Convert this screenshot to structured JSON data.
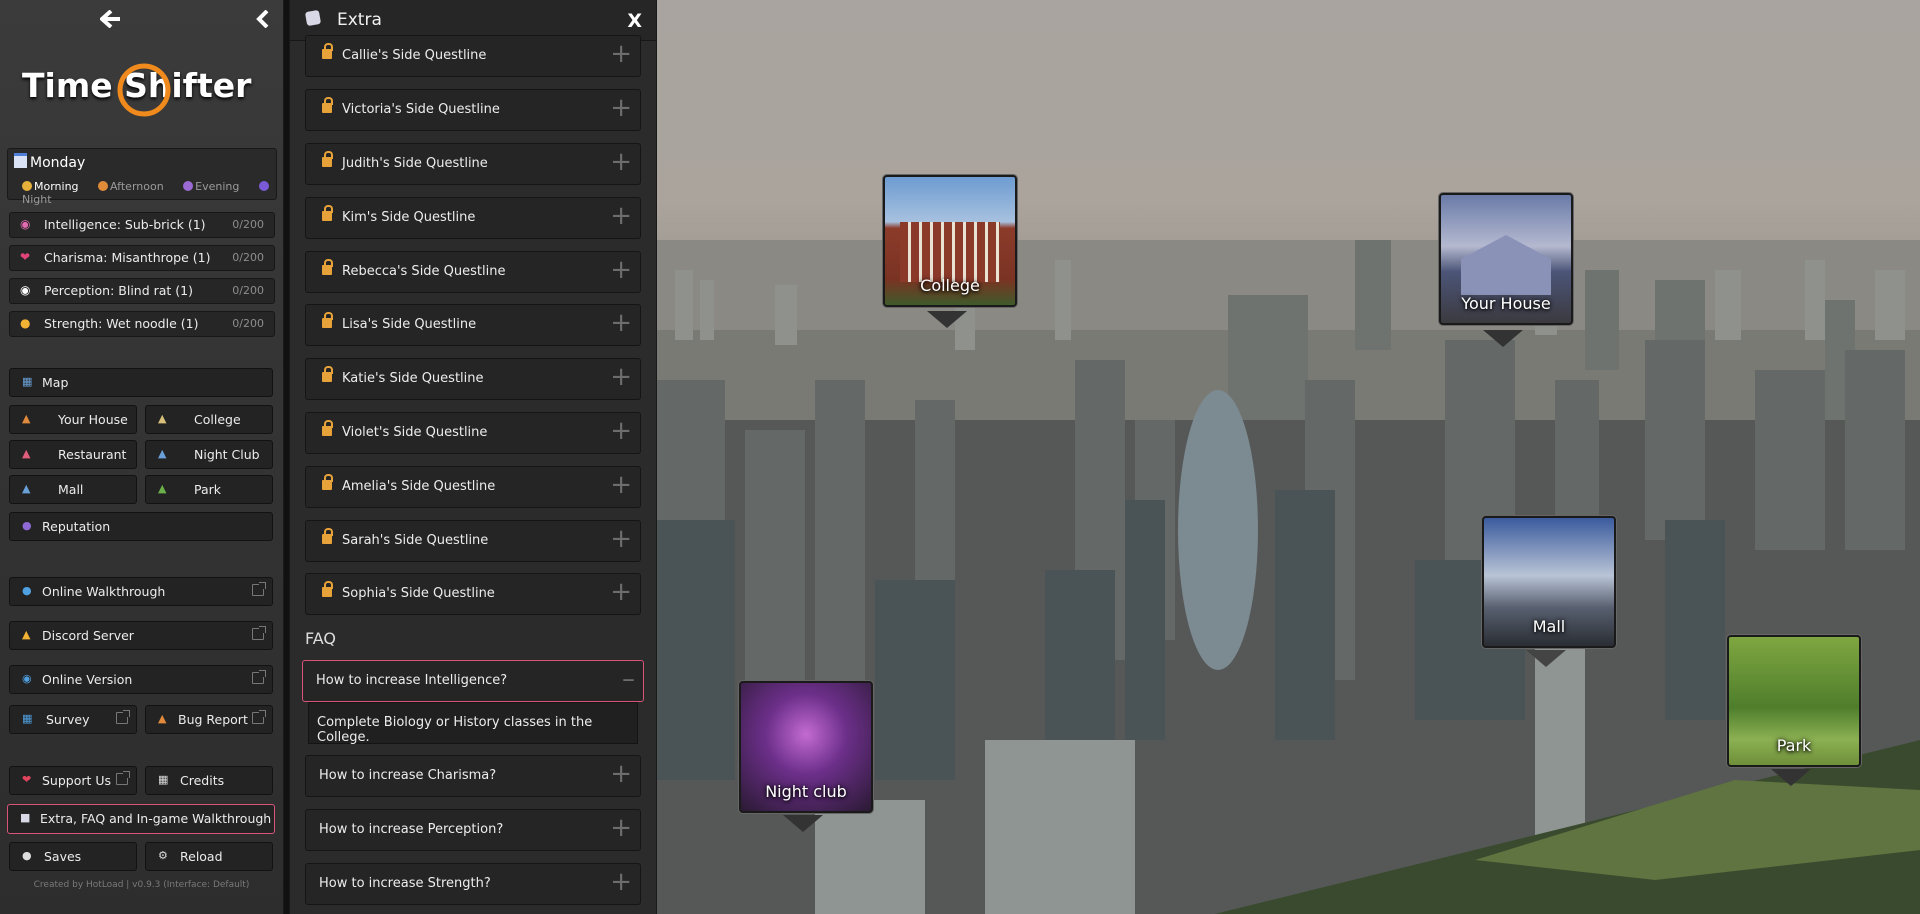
{
  "app": {
    "logo_text": "Time Shifter"
  },
  "day": {
    "name": "Monday",
    "times": [
      {
        "label": "Morning",
        "color": "#e6b13a",
        "active": true
      },
      {
        "label": "Afternoon",
        "color": "#e08b3a",
        "active": false
      },
      {
        "label": "Evening",
        "color": "#9b6bd3",
        "active": false
      },
      {
        "label": "Night",
        "color": "#7a5ad6",
        "active": false
      }
    ]
  },
  "stats": [
    {
      "icon": "brain-icon",
      "label": "Intelligence: Sub-brick (1)",
      "value": "0/200"
    },
    {
      "icon": "lips-icon",
      "label": "Charisma: Misanthrope (1)",
      "value": "0/200"
    },
    {
      "icon": "eyes-icon",
      "label": "Perception: Blind rat (1)",
      "value": "0/200"
    },
    {
      "icon": "muscle-icon",
      "label": "Strength: Wet noodle (1)",
      "value": "0/200"
    }
  ],
  "nav": {
    "map": "Map",
    "locations": [
      "Your House",
      "College",
      "Restaurant",
      "Night Club",
      "Mall",
      "Park"
    ],
    "reputation": "Reputation"
  },
  "links": {
    "walkthrough": "Online Walkthrough",
    "discord": "Discord Server",
    "online_version": "Online Version",
    "survey": "Survey",
    "bug_report": "Bug Report",
    "support": "Support Us",
    "credits": "Credits",
    "extra": "Extra, FAQ and In-game Walkthrough",
    "saves": "Saves",
    "reload": "Reload"
  },
  "footer": "Created by HotLoad | v0.9.3 (Interface: Default)",
  "panel": {
    "title": "Extra",
    "close": "X",
    "questlines": [
      "Callie's Side Questline",
      "Victoria's Side Questline",
      "Judith's Side Questline",
      "Kim's Side Questline",
      "Rebecca's Side Questline",
      "Lisa's Side Questline",
      "Katie's Side Questline",
      "Violet's Side Questline",
      "Amelia's Side Questline",
      "Sarah's Side Questline",
      "Sophia's Side Questline"
    ],
    "faq_title": "FAQ",
    "faq": [
      {
        "q": "How to increase Intelligence?",
        "a": "Complete Biology or History classes in the College.",
        "open": true
      },
      {
        "q": "How to increase Charisma?",
        "open": false
      },
      {
        "q": "How to increase Perception?",
        "open": false
      },
      {
        "q": "How to increase Strength?",
        "open": false
      }
    ]
  },
  "map_pins": [
    {
      "label": "College"
    },
    {
      "label": "Your House"
    },
    {
      "label": "Mall"
    },
    {
      "label": "Night club"
    },
    {
      "label": "Park"
    }
  ]
}
